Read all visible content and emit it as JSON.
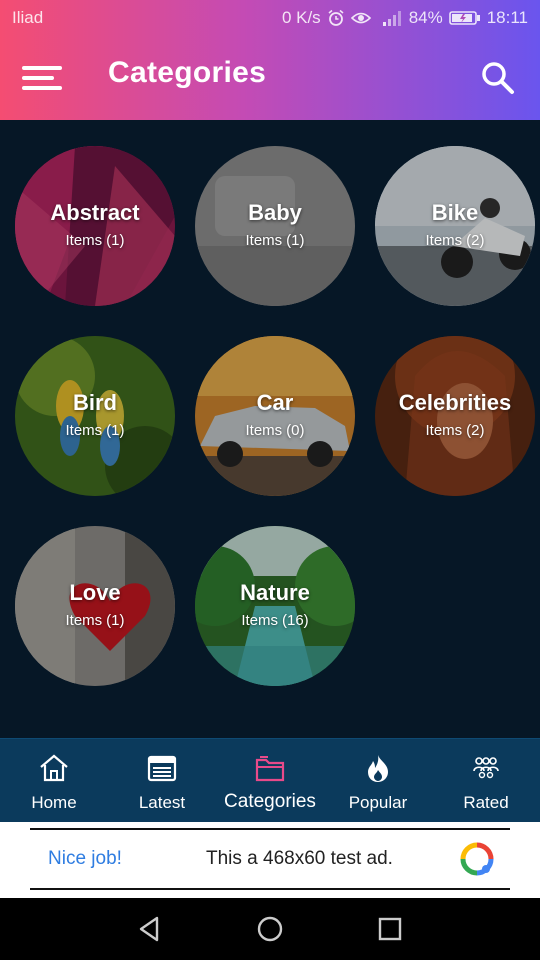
{
  "statusbar": {
    "carrier": "Iliad",
    "speed": "0 K/s",
    "battery": "84%",
    "time": "18:11"
  },
  "appbar": {
    "title": "Categories",
    "menu_icon": "hamburger-menu-icon",
    "search_icon": "search-icon"
  },
  "categories": [
    {
      "name": "Abstract",
      "items_label": "Items",
      "count": "(1)"
    },
    {
      "name": "Baby",
      "items_label": "Items",
      "count": "(1)"
    },
    {
      "name": "Bike",
      "items_label": "Items",
      "count": "(2)"
    },
    {
      "name": "Bird",
      "items_label": "Items",
      "count": "(1)"
    },
    {
      "name": "Car",
      "items_label": "Items",
      "count": "(0)"
    },
    {
      "name": "Celebrities",
      "items_label": "Items",
      "count": "(2)"
    },
    {
      "name": "Love",
      "items_label": "Items",
      "count": "(1)"
    },
    {
      "name": "Nature",
      "items_label": "Items",
      "count": "(16)"
    }
  ],
  "bottom_nav": {
    "items": [
      {
        "label": "Home",
        "icon": "home-icon"
      },
      {
        "label": "Latest",
        "icon": "calendar-icon"
      },
      {
        "label": "Categories",
        "icon": "folder-icon",
        "active": true
      },
      {
        "label": "Popular",
        "icon": "flame-icon"
      },
      {
        "label": "Rated",
        "icon": "group-icon"
      }
    ],
    "active_color": "#e84a8a"
  },
  "ad": {
    "nice": "Nice job!",
    "message": "This a 468x60 test ad."
  },
  "colors": {
    "header_gradient_start": "#f44d72",
    "header_gradient_end": "#6a55ee",
    "background": "#061726",
    "bottom_nav_bg": "#0b3a5c"
  }
}
